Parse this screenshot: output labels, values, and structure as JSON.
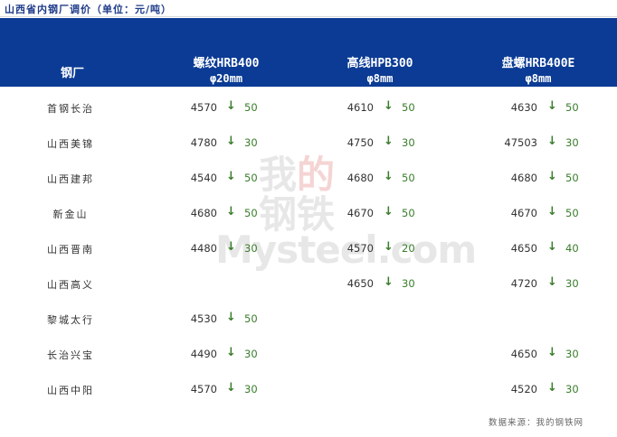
{
  "title": "山西省内钢厂调价（单位：元/吨）",
  "header": {
    "mill": "钢厂",
    "col_a_line1": "螺纹HRB400",
    "col_a_line2": "φ20mm",
    "col_b_line1": "高线HPB300",
    "col_b_line2": "φ8mm",
    "col_c_line1": "盘螺HRB400E",
    "col_c_line2": "φ8mm"
  },
  "arrow_glyph": "↓",
  "rows": [
    {
      "mill": "首钢长治",
      "a_price": "4570",
      "a_chg": "50",
      "b_price": "4610",
      "b_chg": "50",
      "c_price": "4630",
      "c_chg": "50"
    },
    {
      "mill": "山西美锦",
      "a_price": "4780",
      "a_chg": "30",
      "b_price": "4750",
      "b_chg": "30",
      "c_price": "47503",
      "c_chg": "30"
    },
    {
      "mill": "山西建邦",
      "a_price": "4540",
      "a_chg": "50",
      "b_price": "4680",
      "b_chg": "50",
      "c_price": "4680",
      "c_chg": "50"
    },
    {
      "mill": "新金山",
      "a_price": "4680",
      "a_chg": "50",
      "b_price": "4670",
      "b_chg": "50",
      "c_price": "4670",
      "c_chg": "50"
    },
    {
      "mill": "山西晋南",
      "a_price": "4480",
      "a_chg": "30",
      "b_price": "4570",
      "b_chg": "20",
      "c_price": "4650",
      "c_chg": "40"
    },
    {
      "mill": "山西高义",
      "a_price": "",
      "a_chg": "",
      "b_price": "4650",
      "b_chg": "30",
      "c_price": "4720",
      "c_chg": "30"
    },
    {
      "mill": "黎城太行",
      "a_price": "4530",
      "a_chg": "50",
      "b_price": "",
      "b_chg": "",
      "c_price": "",
      "c_chg": ""
    },
    {
      "mill": "长治兴宝",
      "a_price": "4490",
      "a_chg": "30",
      "b_price": "",
      "b_chg": "",
      "c_price": "4650",
      "c_chg": "30"
    },
    {
      "mill": "山西中阳",
      "a_price": "4570",
      "a_chg": "30",
      "b_price": "",
      "b_chg": "",
      "c_price": "4520",
      "c_chg": "30"
    }
  ],
  "watermark": {
    "cn": "我的钢铁",
    "en": "Mysteel.com"
  },
  "source": "数据来源：我的钢铁网",
  "colors": {
    "header_bg": "#0b3b94",
    "down_green": "#3a7d2c"
  }
}
